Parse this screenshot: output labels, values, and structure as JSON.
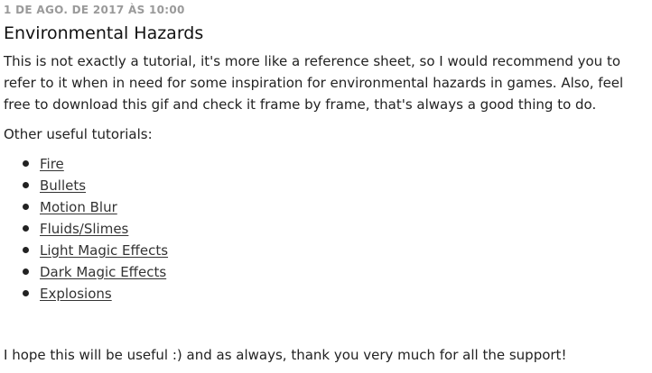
{
  "post": {
    "date": "1 DE AGO. DE 2017 ÀS 10:00",
    "title": "Environmental Hazards",
    "intro": "This is not exactly a tutorial, it's more like a reference sheet, so I would recommend you to refer to it when in need for some inspiration for environmental hazards in games. Also, feel free to download this gif and check it frame by frame, that's always a good thing to do.",
    "subheading": "Other useful tutorials:",
    "tutorials": [
      "Fire",
      "Bullets",
      "Motion Blur",
      "Fluids/Slimes",
      "Light Magic Effects",
      "Dark Magic Effects",
      "Explosions"
    ],
    "closing": "I hope this will be useful :) and as always, thank you very much for all the support!"
  }
}
